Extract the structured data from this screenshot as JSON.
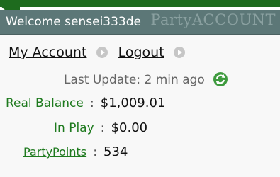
{
  "header": {
    "welcome": "Welcome sensei333de",
    "watermark": "PartyACCOUNT"
  },
  "links": {
    "my_account": "My Account",
    "logout": "Logout"
  },
  "update": {
    "text": "Last Update: 2 min ago"
  },
  "balances": {
    "real_balance_label": "Real Balance",
    "real_balance_value": "$1,009.01",
    "in_play_label": "In Play",
    "in_play_value": "$0.00",
    "party_points_label": "PartyPoints",
    "party_points_value": "534",
    "separator": ":"
  },
  "icons": {
    "arrow": "arrow-right-circle-icon",
    "refresh": "refresh-icon"
  },
  "colors": {
    "header_bg": "#5c7777",
    "accent_green": "#1e7a1e",
    "top_strip": "#1e6b1e"
  }
}
